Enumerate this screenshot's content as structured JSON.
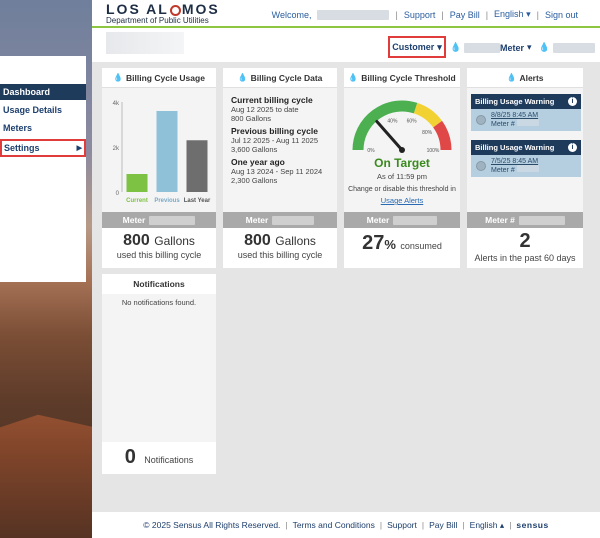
{
  "brand": {
    "name_part1": "LOS AL",
    "name_part2": "MOS",
    "subtitle": "Department of Public Utilities"
  },
  "topnav": {
    "welcome": "Welcome,",
    "support": "Support",
    "pay_bill": "Pay Bill",
    "language": "English",
    "sign_out": "Sign out"
  },
  "subbar": {
    "customer": "Customer",
    "meter": "Meter"
  },
  "sidebar": {
    "items": [
      {
        "label": "Dashboard"
      },
      {
        "label": "Usage Details"
      },
      {
        "label": "Meters"
      },
      {
        "label": "Settings"
      }
    ]
  },
  "usage_card": {
    "title": "Billing Cycle Usage",
    "meter_label": "Meter",
    "amount": "800",
    "unit": "Gallons",
    "caption": "used this billing cycle"
  },
  "chart_data": {
    "type": "bar",
    "categories": [
      "Current",
      "Previous",
      "Last Year"
    ],
    "values": [
      800,
      3600,
      2300
    ],
    "ylim": [
      0,
      4000
    ],
    "yticks": [
      "0",
      "2k",
      "4k"
    ],
    "colors": [
      "#7dc242",
      "#8fc1d9",
      "#6e6e6e"
    ],
    "label_colors": [
      "#7dc242",
      "#7aa9c4",
      "#555555"
    ]
  },
  "data_card": {
    "title": "Billing Cycle Data",
    "current_label": "Current billing cycle",
    "current_range": "Aug 12 2025 to date",
    "current_value": "800 Gallons",
    "previous_label": "Previous billing cycle",
    "previous_range": "Jul 12 2025 - Aug 11 2025",
    "previous_value": "3,600 Gallons",
    "year_label": "One year ago",
    "year_range": "Aug 13 2024 - Sep 11 2024",
    "year_value": "2,300 Gallons",
    "meter_label": "Meter",
    "amount": "800",
    "unit": "Gallons",
    "caption": "used this billing cycle"
  },
  "threshold_card": {
    "title": "Billing Cycle Threshold",
    "status": "On Target",
    "as_of": "As of 11:59 pm",
    "change_text": "Change or disable this threshold in",
    "link": "Usage Alerts",
    "meter_label": "Meter",
    "percent": "27",
    "percent_sign": "%",
    "caption": "consumed",
    "gauge_value": 0.27,
    "gauge_labels": [
      "0%",
      "40%",
      "60%",
      "80%",
      "100%"
    ]
  },
  "alerts_card": {
    "title": "Alerts",
    "alerts": [
      {
        "title": "Billing Usage Warning",
        "time": "8/8/25 8:45 AM",
        "meter": "Meter #"
      },
      {
        "title": "Billing Usage Warning",
        "time": "7/5/25 8:45 AM",
        "meter": "Meter #"
      }
    ],
    "meter_label": "Meter #",
    "count": "2",
    "caption": "Alerts in the past 60 days"
  },
  "notifications_card": {
    "title": "Notifications",
    "empty": "No notifications found.",
    "count": "0",
    "caption": "Notifications"
  },
  "footer": {
    "copyright": "© 2025 Sensus All Rights Reserved.",
    "terms": "Terms and Conditions",
    "support": "Support",
    "pay_bill": "Pay Bill",
    "language": "English",
    "brand": "sensus"
  }
}
